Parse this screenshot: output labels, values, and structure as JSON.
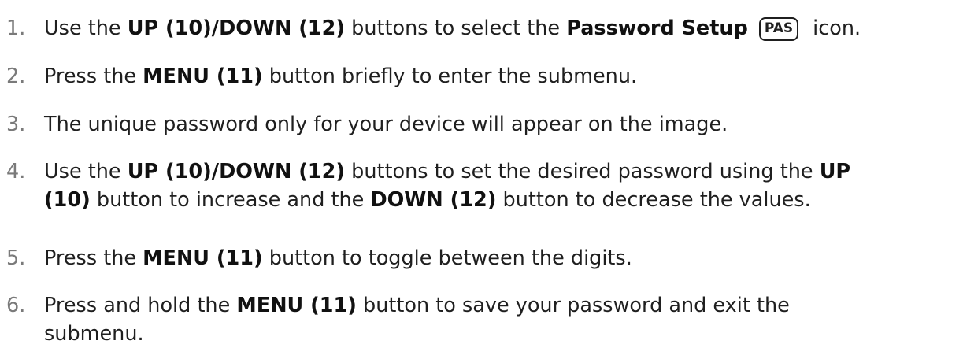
{
  "steps": [
    {
      "number": "1.",
      "t1": "Use the ",
      "b1": "UP (10)/DOWN (12)",
      "t2": " buttons to select the ",
      "b2": "Password Setup",
      "icon_label": "PAS",
      "t3": "icon."
    },
    {
      "number": "2.",
      "t1": "Press the ",
      "b1": "MENU (11)",
      "t2": " button briefly to enter the submenu."
    },
    {
      "number": "3.",
      "t1": "The unique password only for your device will appear on the image."
    },
    {
      "number": "4.",
      "t1": "Use the ",
      "b1": "UP (10)/DOWN (12)",
      "t2": " buttons to set the desired password using the ",
      "b2": "UP",
      "b3": "(10)",
      "t3": " button to increase and the ",
      "b4": "DOWN (12)",
      "t4": " button to decrease the values."
    },
    {
      "number": "5.",
      "t1": "Press the ",
      "b1": "MENU (11)",
      "t2": " button to toggle between the digits."
    },
    {
      "number": "6.",
      "t1": "Press and hold the ",
      "b1": "MENU (11)",
      "t2": " button to save your password and exit the",
      "t3": "submenu."
    }
  ]
}
